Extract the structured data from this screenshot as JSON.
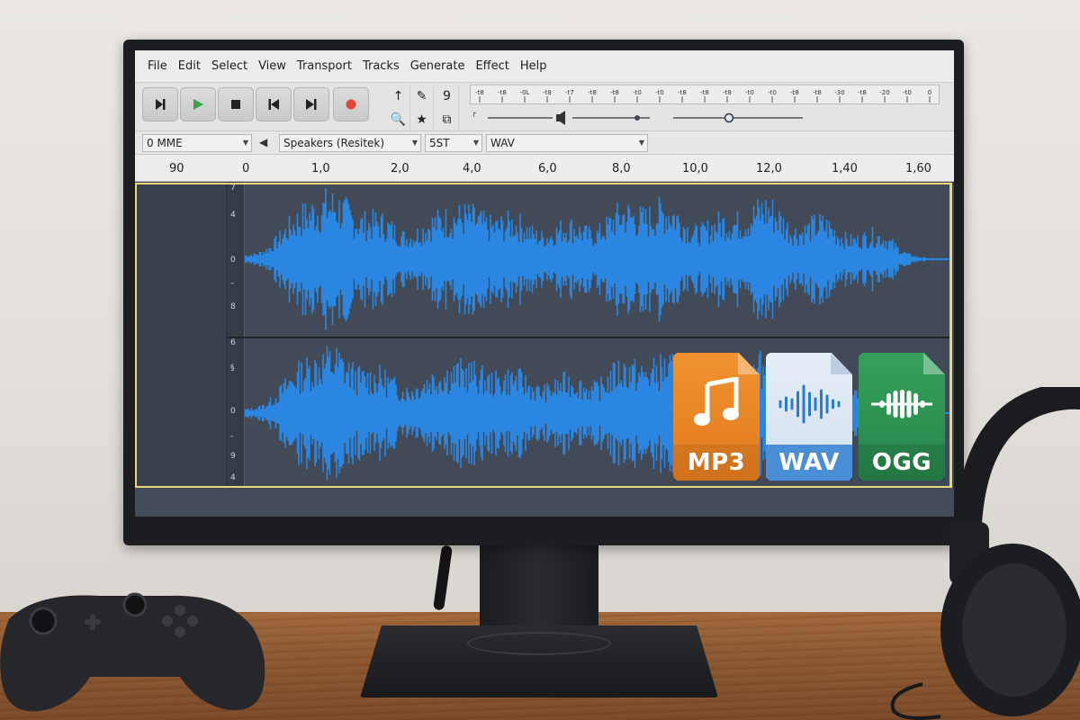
{
  "app": {
    "menu": [
      "File",
      "Edit",
      "Select",
      "View",
      "Transport",
      "Tracks",
      "Generate",
      "Effect",
      "Help"
    ],
    "transport": {
      "buttons": [
        "skip-to-start",
        "play",
        "stop",
        "previous",
        "next",
        "record"
      ]
    },
    "tools": {
      "row1": [
        "↑",
        "✎",
        "9"
      ],
      "row2": [
        "🔍",
        "★",
        "⧉"
      ]
    },
    "meter_ticks": [
      "-t8",
      "-t8",
      "-0L",
      "-t8",
      "-t7",
      "-t8",
      "-t8",
      "-t0",
      "-t0",
      "-t8",
      "-t8",
      "-t8",
      "-t0",
      "-t0",
      "-t8",
      "-t8",
      "-30",
      "-t8",
      "-20",
      "-t0",
      "0"
    ],
    "devices": {
      "host": "0  MME",
      "output": "Speakers (Resitek)",
      "rate": "5ST",
      "format": "WAV"
    },
    "ruler_labels": [
      "90",
      "0",
      "1,0",
      "2,0",
      "4,0",
      "6,0",
      "8,0",
      "10,0",
      "12,0",
      "1,40",
      "1,60"
    ],
    "track1_scale": [
      "7",
      "4",
      "0",
      "–",
      "8"
    ],
    "track2_scale": [
      "6",
      "§",
      "0",
      "-",
      "9",
      "4"
    ],
    "colors": {
      "waveform": "#2a86e0",
      "selection": "#e6d77a",
      "track_bg": "#424957",
      "record": "#e0493a",
      "play": "#3aa34a"
    }
  },
  "overlay_files": [
    {
      "label": "MP3",
      "icon": "music-note-icon",
      "color": "#e8852a"
    },
    {
      "label": "WAV",
      "icon": "waveform-icon",
      "color": "#4a8fd6"
    },
    {
      "label": "OGG",
      "icon": "sound-wave-icon",
      "color": "#2e8a4e"
    }
  ]
}
